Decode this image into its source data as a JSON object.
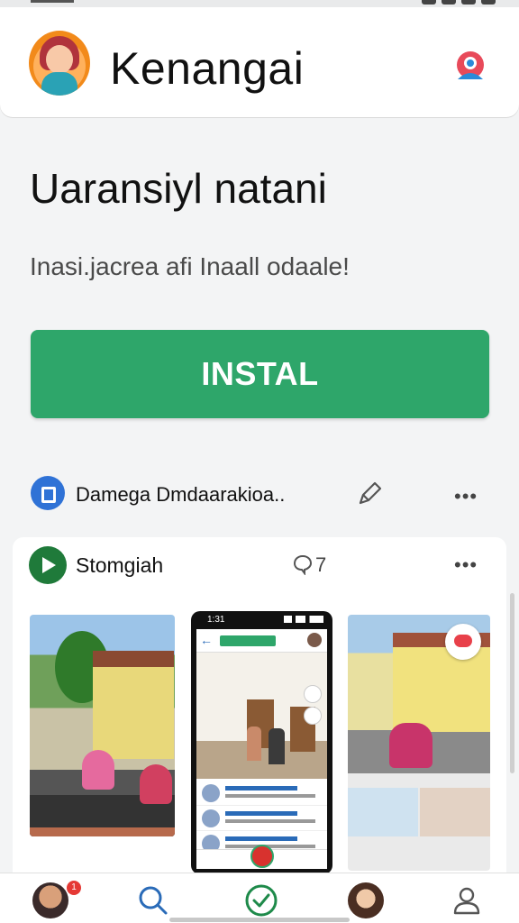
{
  "header": {
    "app_title": "Kenangai",
    "logo_icon": "woman-avatar-logo",
    "account_icon": "account-switch-icon"
  },
  "hero": {
    "title": "Uaransiyl natani",
    "subtitle": "Inasi.jacrea afi Inaall odaale!",
    "install_label": "INSTAL",
    "install_color": "#2ea66a"
  },
  "developer": {
    "name": "Damega Dmdaarakioa..",
    "icon": "developer-icon",
    "edit_icon": "pencil-icon",
    "more": "•••"
  },
  "card": {
    "name": "Stomgiah",
    "comment_count": "7",
    "more": "•••",
    "phone_time": "1:31"
  },
  "bottom_nav": {
    "items": [
      "avatar",
      "search-icon",
      "check-circle-icon",
      "profile-photo",
      "person-icon"
    ],
    "badge": "1"
  }
}
